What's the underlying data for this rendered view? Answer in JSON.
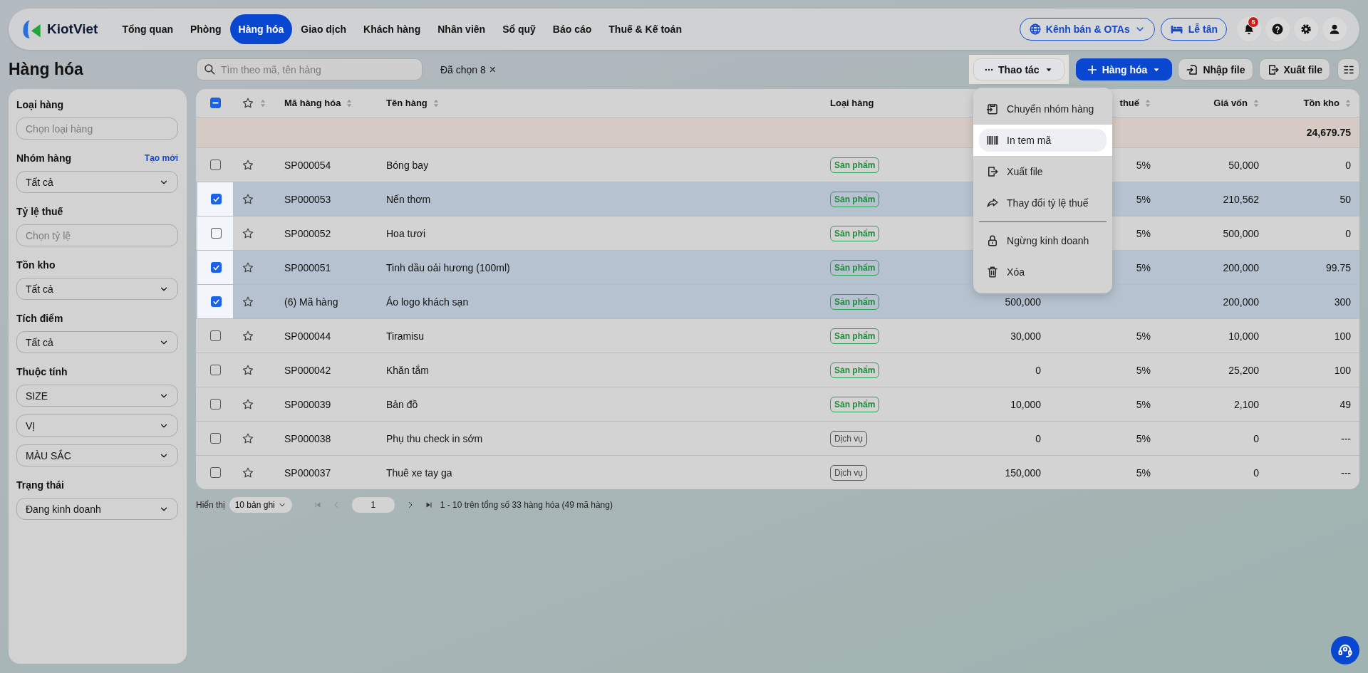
{
  "app": {
    "brand": "KiotViet"
  },
  "nav": {
    "items": [
      {
        "label": "Tổng quan",
        "selected": false
      },
      {
        "label": "Phòng",
        "selected": false
      },
      {
        "label": "Hàng hóa",
        "selected": true
      },
      {
        "label": "Giao dịch",
        "selected": false
      },
      {
        "label": "Khách hàng",
        "selected": false
      },
      {
        "label": "Nhân viên",
        "selected": false
      },
      {
        "label": "Sổ quỹ",
        "selected": false
      },
      {
        "label": "Báo cáo",
        "selected": false
      },
      {
        "label": "Thuế & Kế toán",
        "selected": false
      }
    ],
    "channels_button": "Kênh bán & OTAs",
    "reception_button": "Lễ tân",
    "notification_count": "5"
  },
  "page_title": "Hàng hóa",
  "filters": [
    {
      "label": "Loại hàng",
      "fields": [
        {
          "kind": "input",
          "placeholder": "Chọn loại hàng"
        }
      ]
    },
    {
      "label": "Nhóm hàng",
      "link": "Tạo mới",
      "fields": [
        {
          "kind": "select",
          "value": "Tất cả"
        }
      ]
    },
    {
      "label": "Tỷ lệ thuế",
      "fields": [
        {
          "kind": "input",
          "placeholder": "Chọn tỷ lệ"
        }
      ]
    },
    {
      "label": "Tồn kho",
      "fields": [
        {
          "kind": "select",
          "value": "Tất cả"
        }
      ]
    },
    {
      "label": "Tích điểm",
      "fields": [
        {
          "kind": "select",
          "value": "Tất cả"
        }
      ]
    },
    {
      "label": "Thuộc tính",
      "fields": [
        {
          "kind": "select",
          "value": "SIZE"
        },
        {
          "kind": "select",
          "value": "VỊ"
        },
        {
          "kind": "select",
          "value": "MÀU SẮC"
        }
      ]
    },
    {
      "label": "Trạng thái",
      "fields": [
        {
          "kind": "select",
          "value": "Đang kinh doanh"
        }
      ]
    }
  ],
  "toolbar": {
    "search": {
      "placeholder": "Tìm theo mã, tên hàng"
    },
    "selection": "Đã chọn 8",
    "clear_symbol": "×",
    "actions_button": {
      "label": "Thao tác",
      "spotlit": true
    },
    "add_button": "Hàng hóa",
    "import_button": "Nhập file",
    "export_button": "Xuất file"
  },
  "actions_menu": [
    {
      "label": "Chuyển nhóm hàng",
      "highlighted": false,
      "divider_before": false
    },
    {
      "label": "In tem mã",
      "highlighted": true,
      "divider_before": false
    },
    {
      "label": "Xuất file",
      "highlighted": false,
      "divider_before": false
    },
    {
      "label": "Thay đổi tỷ lệ thuế",
      "highlighted": false,
      "divider_before": false
    },
    {
      "label": "Ngừng kinh doanh",
      "highlighted": false,
      "divider_before": true
    },
    {
      "label": "Xóa",
      "highlighted": false,
      "divider_before": false
    }
  ],
  "table": {
    "header_checkbox": {
      "checked": true,
      "partial": true
    },
    "columns": {
      "code": {
        "label": "Mã hàng hóa",
        "sortable": true
      },
      "name": {
        "label": "Tên hàng",
        "sortable": true
      },
      "type": {
        "label": "Loại hàng"
      },
      "tax": {
        "label": "thuế",
        "sortable": true
      },
      "cost": {
        "label": "Giá vốn",
        "sortable": true
      },
      "stock": {
        "label": "Tồn kho",
        "sortable": true
      }
    },
    "summary": {
      "stock": "24,679.75"
    },
    "rows": [
      {
        "checked": false,
        "spotlit": false,
        "code": "SP000054",
        "name": "Bóng bay",
        "type": "Sản phẩm",
        "kind": "product",
        "tax": "5%",
        "cost": "50,000",
        "stock": "0"
      },
      {
        "checked": true,
        "spotlit": true,
        "code": "SP000053",
        "name": "Nến thơm",
        "type": "Sản phẩm",
        "kind": "product",
        "tax": "5%",
        "cost": "210,562",
        "stock": "50"
      },
      {
        "checked": false,
        "spotlit": true,
        "code": "SP000052",
        "name": "Hoa tươi",
        "type": "Sản phẩm",
        "kind": "product",
        "tax": "5%",
        "cost": "500,000",
        "stock": "0"
      },
      {
        "checked": true,
        "spotlit": true,
        "code": "SP000051",
        "name": "Tinh dầu oải hương (100ml)",
        "type": "Sản phẩm",
        "kind": "product",
        "tax": "5%",
        "cost": "200,000",
        "stock": "99.75"
      },
      {
        "checked": true,
        "spotlit": true,
        "code": "(6) Mã hàng",
        "name": "Áo logo khách sạn",
        "type": "Sản phẩm",
        "kind": "product",
        "price": "500,000",
        "cost": "200,000",
        "stock": "300"
      },
      {
        "checked": false,
        "spotlit": false,
        "code": "SP000044",
        "name": "Tiramisu",
        "type": "Sản phẩm",
        "kind": "product",
        "price": "30,000",
        "tax": "5%",
        "cost": "10,000",
        "stock": "100"
      },
      {
        "checked": false,
        "spotlit": false,
        "code": "SP000042",
        "name": "Khăn tắm",
        "type": "Sản phẩm",
        "kind": "product",
        "price": "0",
        "tax": "5%",
        "cost": "25,200",
        "stock": "100"
      },
      {
        "checked": false,
        "spotlit": false,
        "code": "SP000039",
        "name": "Bản đồ",
        "type": "Sản phẩm",
        "kind": "product",
        "price": "10,000",
        "tax": "5%",
        "cost": "2,100",
        "stock": "49"
      },
      {
        "checked": false,
        "spotlit": false,
        "code": "SP000038",
        "name": "Phụ thu check in sớm",
        "type": "Dịch vụ",
        "kind": "service",
        "price": "0",
        "tax": "5%",
        "cost": "0",
        "stock": "---"
      },
      {
        "checked": false,
        "spotlit": false,
        "code": "SP000037",
        "name": "Thuê xe tay ga",
        "type": "Dịch vụ",
        "kind": "service",
        "price": "150,000",
        "tax": "5%",
        "cost": "0",
        "stock": "---"
      }
    ]
  },
  "pager": {
    "label": "Hiển thị",
    "page_size": "10 bản ghi",
    "page": "1",
    "summary": "1 - 10 trên tổng số 33 hàng hóa (49 mã hàng)"
  }
}
